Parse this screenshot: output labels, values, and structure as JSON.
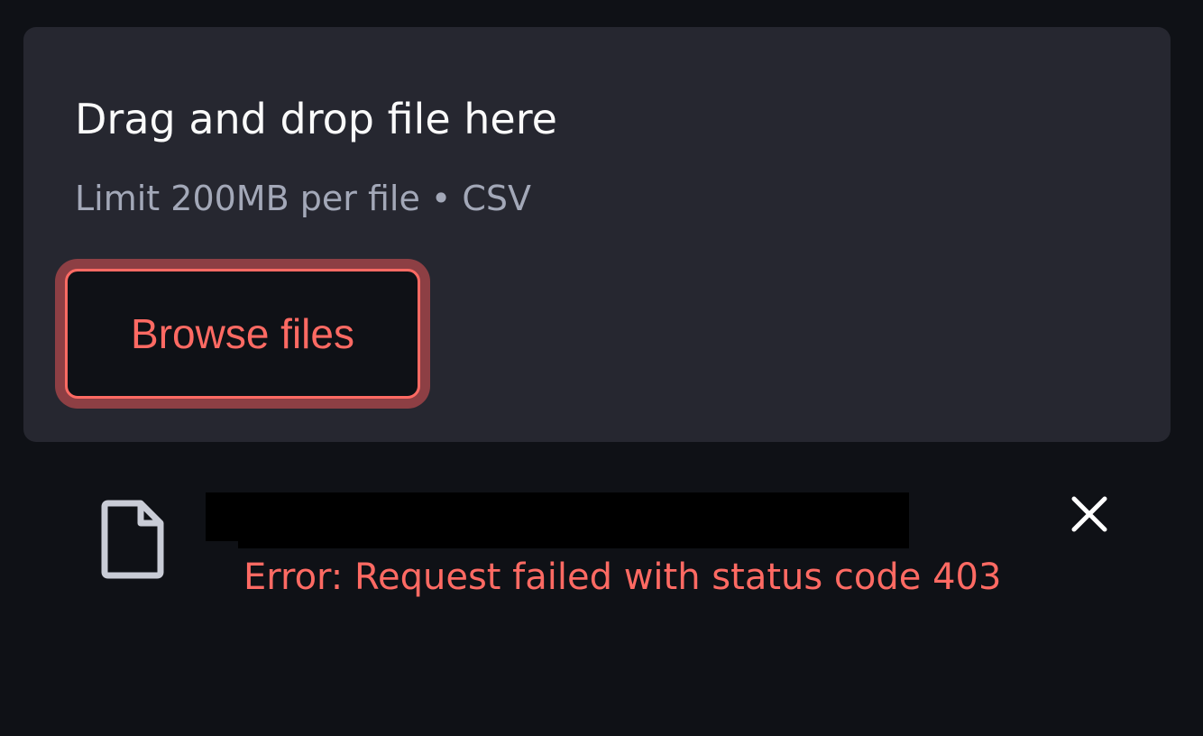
{
  "uploader": {
    "title": "Drag and drop file here",
    "limit_text": "Limit 200MB per file • CSV",
    "browse_label": "Browse files",
    "accent_color": "#ff6a63"
  },
  "file_item": {
    "icon": "file-icon",
    "filename": "",
    "error": "Error: Request failed with status code 403",
    "remove_icon": "close-icon"
  }
}
